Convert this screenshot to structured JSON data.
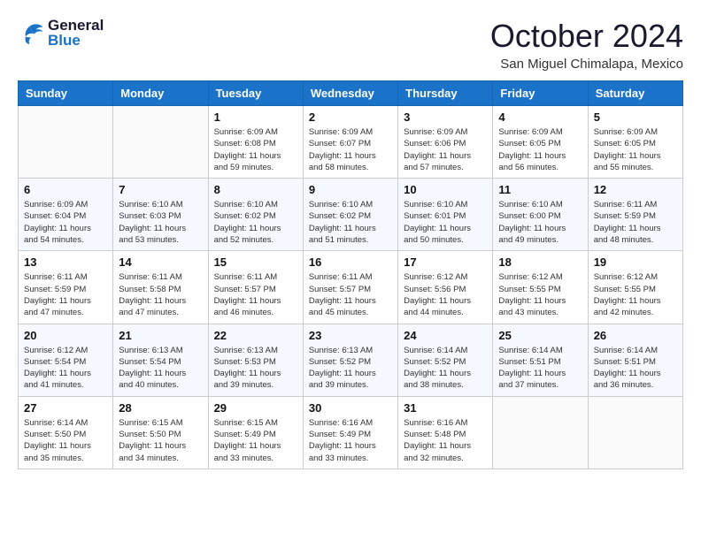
{
  "header": {
    "logo_line1": "General",
    "logo_line2": "Blue",
    "month_title": "October 2024",
    "location": "San Miguel Chimalapa, Mexico"
  },
  "weekdays": [
    "Sunday",
    "Monday",
    "Tuesday",
    "Wednesday",
    "Thursday",
    "Friday",
    "Saturday"
  ],
  "weeks": [
    [
      {
        "day": "",
        "info": ""
      },
      {
        "day": "",
        "info": ""
      },
      {
        "day": "1",
        "info": "Sunrise: 6:09 AM\nSunset: 6:08 PM\nDaylight: 11 hours and 59 minutes."
      },
      {
        "day": "2",
        "info": "Sunrise: 6:09 AM\nSunset: 6:07 PM\nDaylight: 11 hours and 58 minutes."
      },
      {
        "day": "3",
        "info": "Sunrise: 6:09 AM\nSunset: 6:06 PM\nDaylight: 11 hours and 57 minutes."
      },
      {
        "day": "4",
        "info": "Sunrise: 6:09 AM\nSunset: 6:05 PM\nDaylight: 11 hours and 56 minutes."
      },
      {
        "day": "5",
        "info": "Sunrise: 6:09 AM\nSunset: 6:05 PM\nDaylight: 11 hours and 55 minutes."
      }
    ],
    [
      {
        "day": "6",
        "info": "Sunrise: 6:09 AM\nSunset: 6:04 PM\nDaylight: 11 hours and 54 minutes."
      },
      {
        "day": "7",
        "info": "Sunrise: 6:10 AM\nSunset: 6:03 PM\nDaylight: 11 hours and 53 minutes."
      },
      {
        "day": "8",
        "info": "Sunrise: 6:10 AM\nSunset: 6:02 PM\nDaylight: 11 hours and 52 minutes."
      },
      {
        "day": "9",
        "info": "Sunrise: 6:10 AM\nSunset: 6:02 PM\nDaylight: 11 hours and 51 minutes."
      },
      {
        "day": "10",
        "info": "Sunrise: 6:10 AM\nSunset: 6:01 PM\nDaylight: 11 hours and 50 minutes."
      },
      {
        "day": "11",
        "info": "Sunrise: 6:10 AM\nSunset: 6:00 PM\nDaylight: 11 hours and 49 minutes."
      },
      {
        "day": "12",
        "info": "Sunrise: 6:11 AM\nSunset: 5:59 PM\nDaylight: 11 hours and 48 minutes."
      }
    ],
    [
      {
        "day": "13",
        "info": "Sunrise: 6:11 AM\nSunset: 5:59 PM\nDaylight: 11 hours and 47 minutes."
      },
      {
        "day": "14",
        "info": "Sunrise: 6:11 AM\nSunset: 5:58 PM\nDaylight: 11 hours and 47 minutes."
      },
      {
        "day": "15",
        "info": "Sunrise: 6:11 AM\nSunset: 5:57 PM\nDaylight: 11 hours and 46 minutes."
      },
      {
        "day": "16",
        "info": "Sunrise: 6:11 AM\nSunset: 5:57 PM\nDaylight: 11 hours and 45 minutes."
      },
      {
        "day": "17",
        "info": "Sunrise: 6:12 AM\nSunset: 5:56 PM\nDaylight: 11 hours and 44 minutes."
      },
      {
        "day": "18",
        "info": "Sunrise: 6:12 AM\nSunset: 5:55 PM\nDaylight: 11 hours and 43 minutes."
      },
      {
        "day": "19",
        "info": "Sunrise: 6:12 AM\nSunset: 5:55 PM\nDaylight: 11 hours and 42 minutes."
      }
    ],
    [
      {
        "day": "20",
        "info": "Sunrise: 6:12 AM\nSunset: 5:54 PM\nDaylight: 11 hours and 41 minutes."
      },
      {
        "day": "21",
        "info": "Sunrise: 6:13 AM\nSunset: 5:54 PM\nDaylight: 11 hours and 40 minutes."
      },
      {
        "day": "22",
        "info": "Sunrise: 6:13 AM\nSunset: 5:53 PM\nDaylight: 11 hours and 39 minutes."
      },
      {
        "day": "23",
        "info": "Sunrise: 6:13 AM\nSunset: 5:52 PM\nDaylight: 11 hours and 39 minutes."
      },
      {
        "day": "24",
        "info": "Sunrise: 6:14 AM\nSunset: 5:52 PM\nDaylight: 11 hours and 38 minutes."
      },
      {
        "day": "25",
        "info": "Sunrise: 6:14 AM\nSunset: 5:51 PM\nDaylight: 11 hours and 37 minutes."
      },
      {
        "day": "26",
        "info": "Sunrise: 6:14 AM\nSunset: 5:51 PM\nDaylight: 11 hours and 36 minutes."
      }
    ],
    [
      {
        "day": "27",
        "info": "Sunrise: 6:14 AM\nSunset: 5:50 PM\nDaylight: 11 hours and 35 minutes."
      },
      {
        "day": "28",
        "info": "Sunrise: 6:15 AM\nSunset: 5:50 PM\nDaylight: 11 hours and 34 minutes."
      },
      {
        "day": "29",
        "info": "Sunrise: 6:15 AM\nSunset: 5:49 PM\nDaylight: 11 hours and 33 minutes."
      },
      {
        "day": "30",
        "info": "Sunrise: 6:16 AM\nSunset: 5:49 PM\nDaylight: 11 hours and 33 minutes."
      },
      {
        "day": "31",
        "info": "Sunrise: 6:16 AM\nSunset: 5:48 PM\nDaylight: 11 hours and 32 minutes."
      },
      {
        "day": "",
        "info": ""
      },
      {
        "day": "",
        "info": ""
      }
    ]
  ]
}
